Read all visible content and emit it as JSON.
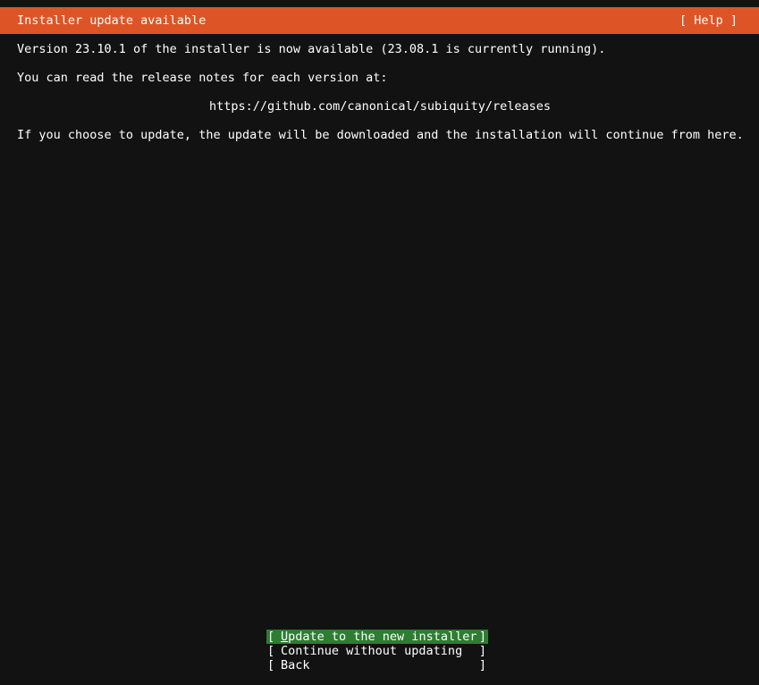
{
  "header": {
    "title": "Installer update available",
    "help": "[ Help ]"
  },
  "body": {
    "line1": "Version 23.10.1 of the installer is now available (23.08.1 is currently running).",
    "line2": "You can read the release notes for each version at:",
    "url": "https://github.com/canonical/subiquity/releases",
    "line3": "If you choose to update, the update will be downloaded and the installation will continue from here."
  },
  "buttons": {
    "update_first": "U",
    "update_rest": "pdate to the new installer",
    "continue": "Continue without updating",
    "back": "Back",
    "left_bracket": "[",
    "right_bracket": "]"
  },
  "colors": {
    "header_bg": "#dd5526",
    "selected_bg": "#2e7d32",
    "background": "#121212",
    "text": "#ffffff"
  }
}
